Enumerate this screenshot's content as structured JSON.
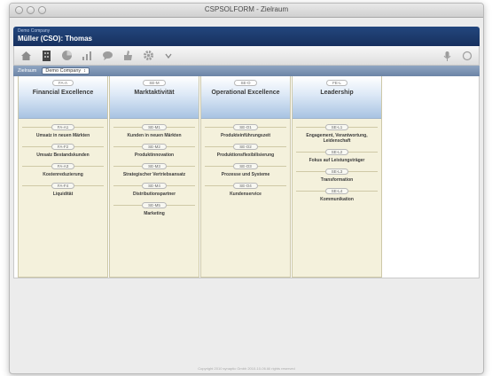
{
  "window": {
    "title": "CSPSOLFORM - Zielraum"
  },
  "header": {
    "company": "Demo Company",
    "user": "Müller (CSO): Thomas"
  },
  "toolbar": {
    "icons": [
      "home-icon",
      "building-icon",
      "chart-pie-icon",
      "bar-chart-icon",
      "speech-bubble-icon",
      "thumbs-icon",
      "gear-icon",
      "dropdown-arrow-icon"
    ],
    "right_icons": [
      "microphone-icon",
      "power-icon"
    ]
  },
  "filter": {
    "label": "Zielraum",
    "selected": "Demo Company",
    "caret": "↕"
  },
  "columns": [
    {
      "code": "FA-A",
      "title": "Financial Excellence",
      "objectives": [
        {
          "code": "FA-A1",
          "label": "Umsatz in neuen Märkten"
        },
        {
          "code": "FA-F2",
          "label": "Umsatz Bestandskunden"
        },
        {
          "code": "FA-A3",
          "label": "Kostenreduzierung"
        },
        {
          "code": "FA-F4",
          "label": "Liquidität"
        }
      ]
    },
    {
      "code": "SE-M",
      "title": "Marktaktivität",
      "objectives": [
        {
          "code": "SE-M1",
          "label": "Kunden in neuen Märkten"
        },
        {
          "code": "SE-M2",
          "label": "Produktinnovation"
        },
        {
          "code": "SE-M3",
          "label": "Strategischer Vertriebsansatz"
        },
        {
          "code": "SE-M4",
          "label": "Distributionspartner"
        },
        {
          "code": "SE-M5",
          "label": "Marketing"
        }
      ]
    },
    {
      "code": "SE-O",
      "title": "Operational Excellence",
      "objectives": [
        {
          "code": "SE-O1",
          "label": "Produkteinführungszeit"
        },
        {
          "code": "SE-O2",
          "label": "Produktionsflexibilisierung"
        },
        {
          "code": "SE-O3",
          "label": "Prozesse und Systeme"
        },
        {
          "code": "SE-O4",
          "label": "Kundenservice"
        }
      ]
    },
    {
      "code": "FE-L",
      "title": "Leadership",
      "objectives": [
        {
          "code": "SE-L1",
          "label": "Engagement, Verantwortung, Leidenschaft"
        },
        {
          "code": "SE-L2",
          "label": "Fokus auf Leistungsträger"
        },
        {
          "code": "SE-L3",
          "label": "Transformation"
        },
        {
          "code": "SE-L4",
          "label": "Kommunikation"
        }
      ]
    }
  ],
  "footer": {
    "text": "Copyright 2010 synaptic Gmbh 2010-10-06 All rights reserved"
  }
}
